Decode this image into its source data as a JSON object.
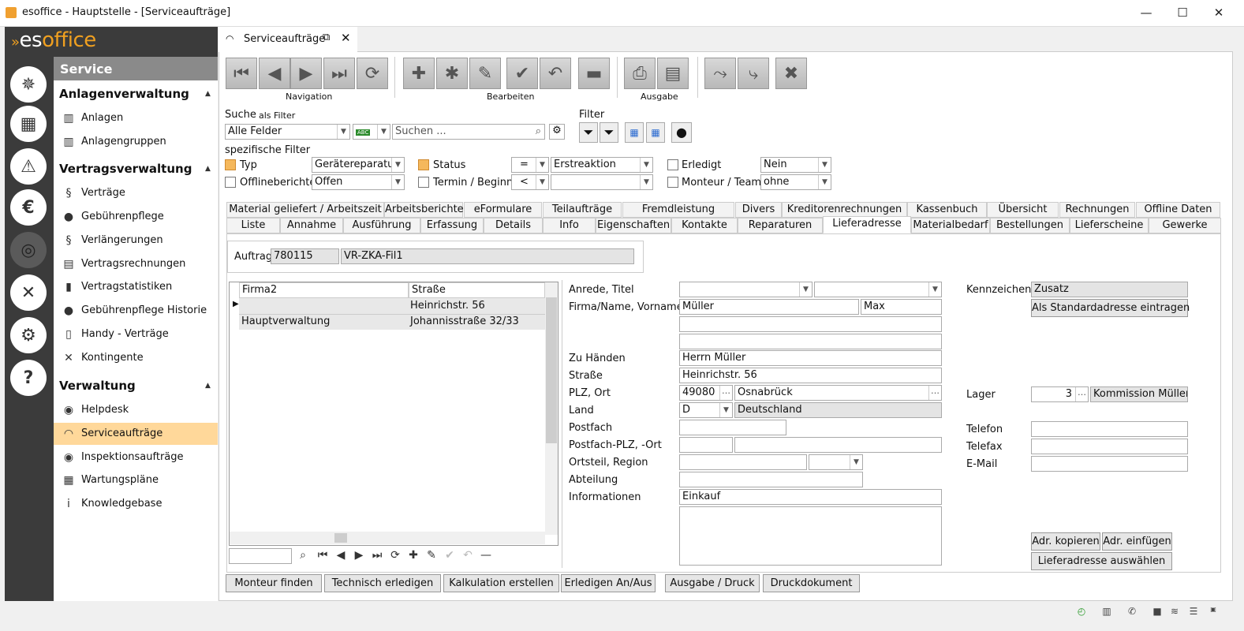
{
  "window": {
    "title": "esoffice - Hauptstelle - [Serviceaufträge]",
    "minimize_icon": "minimize-icon",
    "maximize_icon": "maximize-icon",
    "close_icon": "close-icon"
  },
  "brand": {
    "part1": "es",
    "part2": "office"
  },
  "rail": [
    {
      "name": "ship-wheel-icon",
      "glyph": "✵"
    },
    {
      "name": "plan-icon",
      "glyph": "▦"
    },
    {
      "name": "alarm-light-icon",
      "glyph": "⚠"
    },
    {
      "name": "cash-icon",
      "glyph": "€"
    },
    {
      "name": "headset-icon",
      "glyph": "◎"
    },
    {
      "name": "tools-icon",
      "glyph": "✕"
    },
    {
      "name": "gears-icon",
      "glyph": "⚙"
    },
    {
      "name": "help-icon",
      "glyph": "?"
    }
  ],
  "sidebar": {
    "header": "Service",
    "sections": [
      {
        "title": "Anlagenverwaltung"
      },
      {
        "title": "Vertragsverwaltung"
      },
      {
        "title": "Verwaltung"
      }
    ],
    "items": [
      {
        "label": "Anlagen",
        "icon": "factory-icon",
        "glyph": "▥"
      },
      {
        "label": "Anlagengruppen",
        "icon": "factory-group-icon",
        "glyph": "▥"
      },
      {
        "label": "Verträge",
        "icon": "paragraph-icon",
        "glyph": "§"
      },
      {
        "label": "Gebührenpflege",
        "icon": "money-bag-icon",
        "glyph": "●"
      },
      {
        "label": "Verlängerungen",
        "icon": "renewal-icon",
        "glyph": "§"
      },
      {
        "label": "Vertragsrechnungen",
        "icon": "invoice-icon",
        "glyph": "▤"
      },
      {
        "label": "Vertragstatistiken",
        "icon": "statistics-icon",
        "glyph": "▮"
      },
      {
        "label": "Gebührenpflege Historie",
        "icon": "history-bag-icon",
        "glyph": "●"
      },
      {
        "label": "Handy - Verträge",
        "icon": "mobile-phone-icon",
        "glyph": "▯"
      },
      {
        "label": "Kontingente",
        "icon": "tools-icon",
        "glyph": "✕"
      },
      {
        "label": "Helpdesk",
        "icon": "lifebuoy-icon",
        "glyph": "◉"
      },
      {
        "label": "Serviceaufträge",
        "icon": "headset-icon",
        "glyph": "◠"
      },
      {
        "label": "Inspektionsaufträge",
        "icon": "eye-icon",
        "glyph": "◉"
      },
      {
        "label": "Wartungspläne",
        "icon": "calendar-icon",
        "glyph": "▦"
      },
      {
        "label": "Knowledgebase",
        "icon": "info-icon",
        "glyph": "i"
      }
    ]
  },
  "doc_tab": {
    "label": "Serviceaufträge"
  },
  "toolbar": {
    "groups": [
      "Navigation",
      "Bearbeiten",
      "Ausgabe"
    ],
    "buttons": [
      {
        "name": "first-record-button",
        "glyph": "⏮"
      },
      {
        "name": "previous-record-button",
        "glyph": "◀"
      },
      {
        "name": "next-record-button",
        "glyph": "▶"
      },
      {
        "name": "last-record-button",
        "glyph": "⏭"
      },
      {
        "name": "refresh-button",
        "glyph": "⟳"
      },
      {
        "name": "add-button",
        "glyph": "✚"
      },
      {
        "name": "add-multiple-button",
        "glyph": "✱"
      },
      {
        "name": "edit-button",
        "glyph": "✎"
      },
      {
        "name": "save-button",
        "glyph": "✔"
      },
      {
        "name": "undo-button",
        "glyph": "↶"
      },
      {
        "name": "delete-button",
        "glyph": "▬"
      },
      {
        "name": "print-button",
        "glyph": "⎙"
      },
      {
        "name": "export-list-button",
        "glyph": "▤"
      },
      {
        "name": "walk-out-button",
        "glyph": "⤳"
      },
      {
        "name": "run-button",
        "glyph": "⤷"
      },
      {
        "name": "close-record-button",
        "glyph": "✖"
      }
    ]
  },
  "search": {
    "label": "Suche",
    "as_filter": "als Filter",
    "field_select": "Alle Felder",
    "placeholder": "Suchen ...",
    "abc_badge": "ABC"
  },
  "filter": {
    "label": "Filter"
  },
  "specific": {
    "label": "spezifische Filter",
    "typ_label": "Typ",
    "typ_value": "Gerätereparatur",
    "offline_label": "Offlineberichte",
    "offline_value": "Offen",
    "status_label": "Status",
    "status_op": "=",
    "status_value": "Erstreaktion",
    "termin_label": "Termin / Beginn",
    "termin_op": "<",
    "termin_value": "",
    "erledigt_label": "Erledigt",
    "erledigt_value": "Nein",
    "monteur_label": "Monteur / Team",
    "monteur_value": "ohne"
  },
  "tabs_row1": [
    "Material geliefert / Arbeitszeit",
    "Arbeitsberichte",
    "eFormulare",
    "Teilaufträge",
    "Fremdleistung",
    "Divers",
    "Kreditorenrechnungen",
    "Kassenbuch",
    "Übersicht",
    "Rechnungen",
    "Offline Daten"
  ],
  "tabs_row2": [
    "Liste",
    "Annahme",
    "Ausführung",
    "Erfassung",
    "Details",
    "Info",
    "Eigenschaften",
    "Kontakte",
    "Reparaturen",
    "Lieferadresse",
    "Materialbedarf",
    "Bestellungen",
    "Lieferscheine",
    "Gewerke"
  ],
  "auftrag": {
    "label": "Auftrag",
    "number": "780115",
    "name": "VR-ZKA-Fil1"
  },
  "grid": {
    "columns": [
      "Firma2",
      "Straße"
    ],
    "rows": [
      {
        "firma2": "",
        "strasse": "Heinrichstr. 56"
      },
      {
        "firma2": "Hauptverwaltung",
        "strasse": "Johannisstraße 32/33"
      }
    ]
  },
  "form": {
    "anrede_label": "Anrede, Titel",
    "anrede": "",
    "titel": "",
    "firma_label": "Firma/Name, Vorname",
    "name": "Müller",
    "vorname": "Max",
    "name2": "",
    "name3": "",
    "zuhaenden_label": "Zu Händen",
    "zuhaenden": "Herrn Müller",
    "strasse_label": "Straße",
    "strasse": "Heinrichstr. 56",
    "plz_label": "PLZ, Ort",
    "plz": "49080",
    "ort": "Osnabrück",
    "land_label": "Land",
    "land_code": "D",
    "land": "Deutschland",
    "postfach_label": "Postfach",
    "postfach": "",
    "postfachplz_label": "Postfach-PLZ, -Ort",
    "postfach_plz": "",
    "postfach_ort": "",
    "ortsteil_label": "Ortsteil, Region",
    "ortsteil": "",
    "region": "",
    "abteilung_label": "Abteilung",
    "abteilung": "",
    "informationen_label": "Informationen",
    "informationen": "Einkauf"
  },
  "right": {
    "kennzeichen_label": "Kennzeichen",
    "zusatz": "Zusatz",
    "std_button": "Als Standardadresse eintragen",
    "lager_label": "Lager",
    "lager": "3",
    "lager_name": "Kommission Müller",
    "telefon_label": "Telefon",
    "telefax_label": "Telefax",
    "email_label": "E-Mail",
    "copy_button": "Adr. kopieren",
    "paste_button": "Adr. einfügen",
    "select_button": "Lieferadresse auswählen"
  },
  "bottom_buttons": [
    "Monteur finden",
    "Technisch erledigen",
    "Kalkulation erstellen",
    "Erledigen An/Aus",
    "Ausgabe / Druck",
    "Druckdokument"
  ],
  "colors": {
    "accent": "#f0a020",
    "selected": "#ffd89a",
    "rail": "#3b3b3b"
  }
}
